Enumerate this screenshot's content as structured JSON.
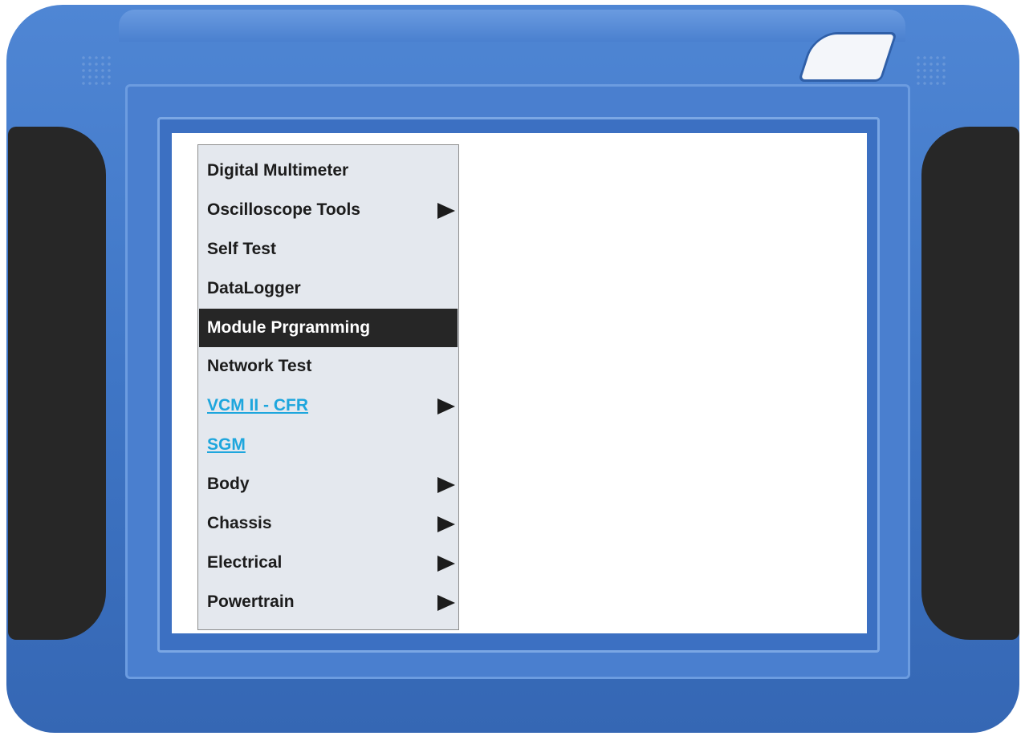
{
  "menu": {
    "items": [
      {
        "label": "Digital Multimeter",
        "submenu": false,
        "style": "normal"
      },
      {
        "label": "Oscilloscope Tools",
        "submenu": true,
        "style": "normal"
      },
      {
        "label": "Self Test",
        "submenu": false,
        "style": "normal"
      },
      {
        "label": "DataLogger",
        "submenu": false,
        "style": "normal"
      },
      {
        "label": "Module Prgramming",
        "submenu": false,
        "style": "selected"
      },
      {
        "label": "Network Test",
        "submenu": false,
        "style": "normal"
      },
      {
        "label": "VCM II - CFR",
        "submenu": true,
        "style": "link"
      },
      {
        "label": "SGM",
        "submenu": false,
        "style": "link"
      },
      {
        "label": "Body",
        "submenu": true,
        "style": "normal"
      },
      {
        "label": "Chassis",
        "submenu": true,
        "style": "normal"
      },
      {
        "label": "Electrical",
        "submenu": true,
        "style": "normal"
      },
      {
        "label": "Powertrain",
        "submenu": true,
        "style": "normal"
      }
    ]
  },
  "colors": {
    "device_blue": "#4a7fcf",
    "grip_black": "#272727",
    "menu_bg": "#e4e8ee",
    "selected_bg": "#262626",
    "link_blue": "#1ea6dd"
  },
  "icons": {
    "submenu": "right-triangle-arrow-icon"
  }
}
